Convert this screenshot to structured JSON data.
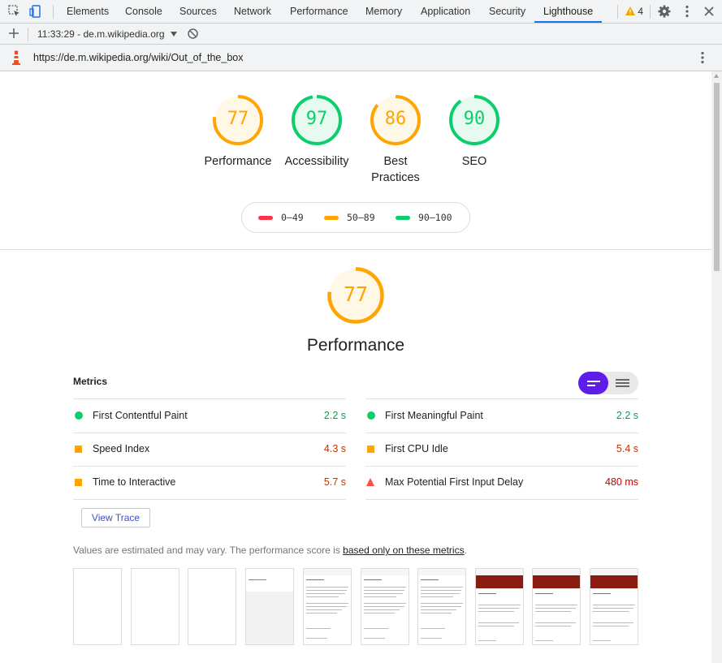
{
  "devtools": {
    "tabs": [
      "Elements",
      "Console",
      "Sources",
      "Network",
      "Performance",
      "Memory",
      "Application",
      "Security",
      "Lighthouse"
    ],
    "active_tab": "Lighthouse",
    "warning_count": "4",
    "accent_color": "#1a73e8"
  },
  "report_bar": {
    "report_selector": "11:33:29 - de.m.wikipedia.org",
    "url": "https://de.m.wikipedia.org/wiki/Out_of_the_box"
  },
  "scores": [
    {
      "label": "Performance",
      "score": "77",
      "value": 77,
      "color": "#ffa400",
      "fill": "#fff8e6"
    },
    {
      "label": "Accessibility",
      "score": "97",
      "value": 97,
      "color": "#0cce6b",
      "fill": "#e7faf0"
    },
    {
      "label": "Best Practices",
      "score": "86",
      "value": 86,
      "color": "#ffa400",
      "fill": "#fff8e6"
    },
    {
      "label": "SEO",
      "score": "90",
      "value": 90,
      "color": "#0cce6b",
      "fill": "#e7faf0"
    }
  ],
  "legend": [
    {
      "range": "0–49",
      "color": "#ff3344"
    },
    {
      "range": "50–89",
      "color": "#ffa400"
    },
    {
      "range": "90–100",
      "color": "#0cce6b"
    }
  ],
  "performance": {
    "title": "Performance",
    "score": "77",
    "value": 77,
    "metrics_heading": "Metrics",
    "metrics_left": [
      {
        "name": "First Contentful Paint",
        "value": "2.2 s",
        "status": "pass",
        "color": "#0c9c4c"
      },
      {
        "name": "Speed Index",
        "value": "4.3 s",
        "status": "average",
        "color": "#c33300"
      },
      {
        "name": "Time to Interactive",
        "value": "5.7 s",
        "status": "average",
        "color": "#c33300"
      }
    ],
    "metrics_right": [
      {
        "name": "First Meaningful Paint",
        "value": "2.2 s",
        "status": "pass",
        "color": "#0c9c4c"
      },
      {
        "name": "First CPU Idle",
        "value": "5.4 s",
        "status": "average",
        "color": "#c33300"
      },
      {
        "name": "Max Potential First Input Delay",
        "value": "480 ms",
        "status": "fail",
        "color": "#cc0000"
      }
    ],
    "view_trace_label": "View Trace",
    "disclaimer_text": "Values are estimated and may vary. The performance score is ",
    "disclaimer_link": "based only on these metrics",
    "disclaimer_end": "."
  }
}
